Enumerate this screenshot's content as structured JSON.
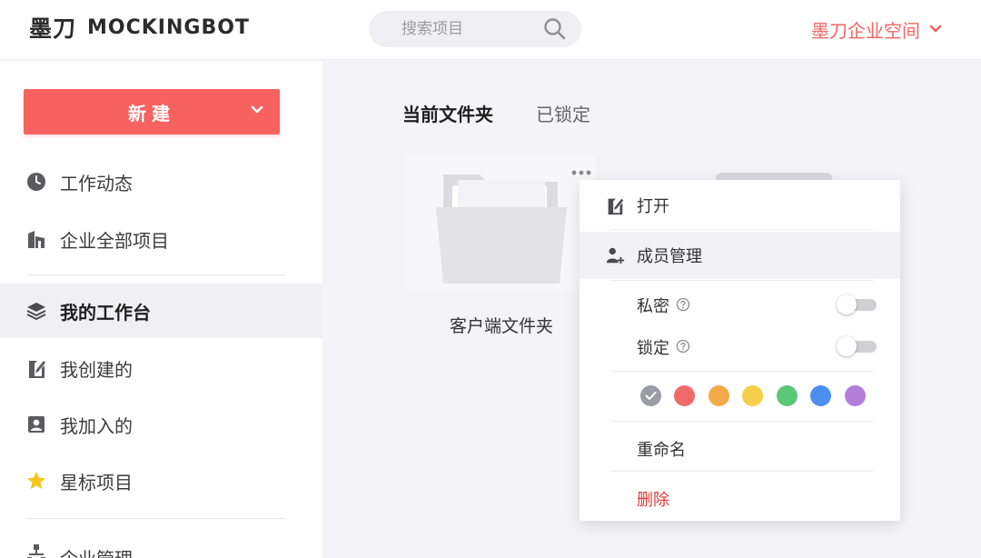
{
  "header": {
    "logo_cn": "墨刀",
    "logo_en": "MOCKINGBOT",
    "search_placeholder": "搜索项目",
    "workspace_label": "墨刀企业空间"
  },
  "sidebar": {
    "new_button": "新建",
    "items": [
      {
        "label": "工作动态",
        "icon": "clock-icon"
      },
      {
        "label": "企业全部项目",
        "icon": "building-icon"
      },
      {
        "label": "我的工作台",
        "icon": "layers-icon",
        "active": true
      },
      {
        "label": "我创建的",
        "icon": "edit-doc-icon"
      },
      {
        "label": "我加入的",
        "icon": "person-badge-icon"
      },
      {
        "label": "星标项目",
        "icon": "star-icon"
      },
      {
        "label": "企业管理",
        "icon": "org-chart-icon"
      }
    ]
  },
  "main": {
    "tabs": [
      "当前文件夹",
      "已锁定"
    ],
    "folder_name": "客户端文件夹"
  },
  "context_menu": {
    "open": "打开",
    "members": "成员管理",
    "private": "私密",
    "locked": "锁定",
    "rename": "重命名",
    "delete": "删除",
    "colors": [
      "#9c9ca6",
      "#ef6a6a",
      "#f4a94a",
      "#f5cf4a",
      "#5cc778",
      "#4c8ef0",
      "#b47ddb"
    ]
  },
  "colors": {
    "accent": "#f6625f",
    "workspace": "#f06565",
    "danger": "#e03a3a"
  }
}
